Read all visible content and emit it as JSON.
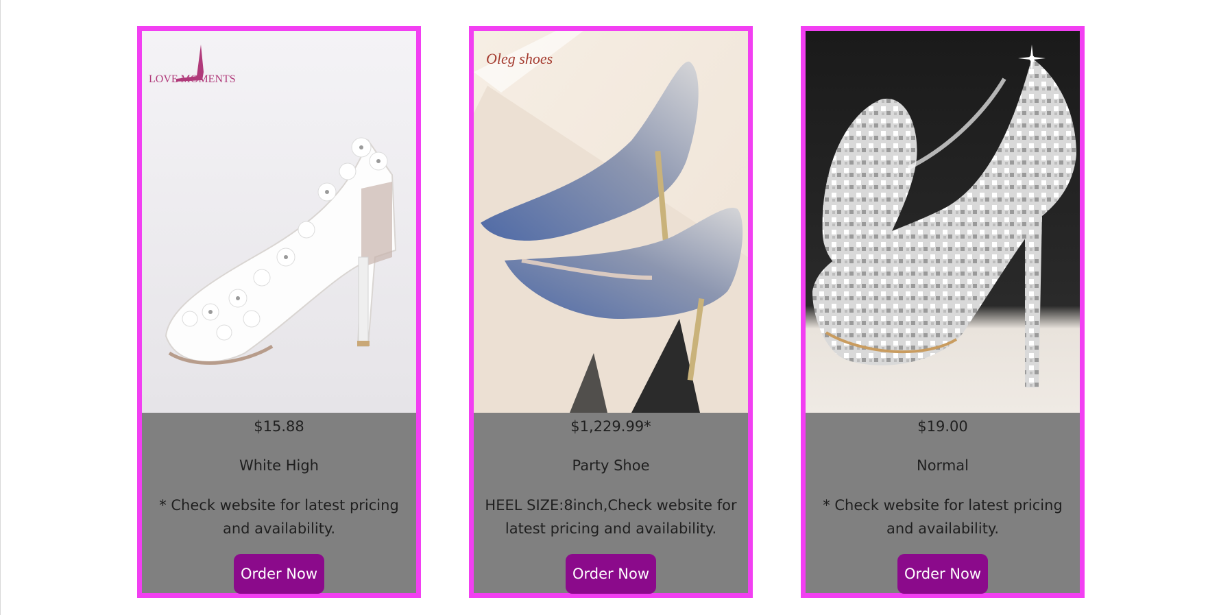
{
  "products": [
    {
      "price": "$15.88",
      "name": "White High",
      "description": "* Check website for latest pricing and availability.",
      "button_label": "Order Now",
      "brand_text": "LOVE MOMENTS"
    },
    {
      "price": "$1,229.99*",
      "name": "Party Shoe",
      "description": "HEEL SIZE:8inch,Check website for latest pricing and availability.",
      "button_label": "Order Now",
      "brand_text": "Oleg shoes"
    },
    {
      "price": "$19.00",
      "name": "Normal",
      "description": "* Check website for latest pricing and availability.",
      "button_label": "Order Now"
    }
  ],
  "colors": {
    "card_border": "#f23ff2",
    "card_body": "#808080",
    "button_bg": "#8b0a8b",
    "button_text": "#ffffff",
    "text": "#1f1f1f"
  }
}
